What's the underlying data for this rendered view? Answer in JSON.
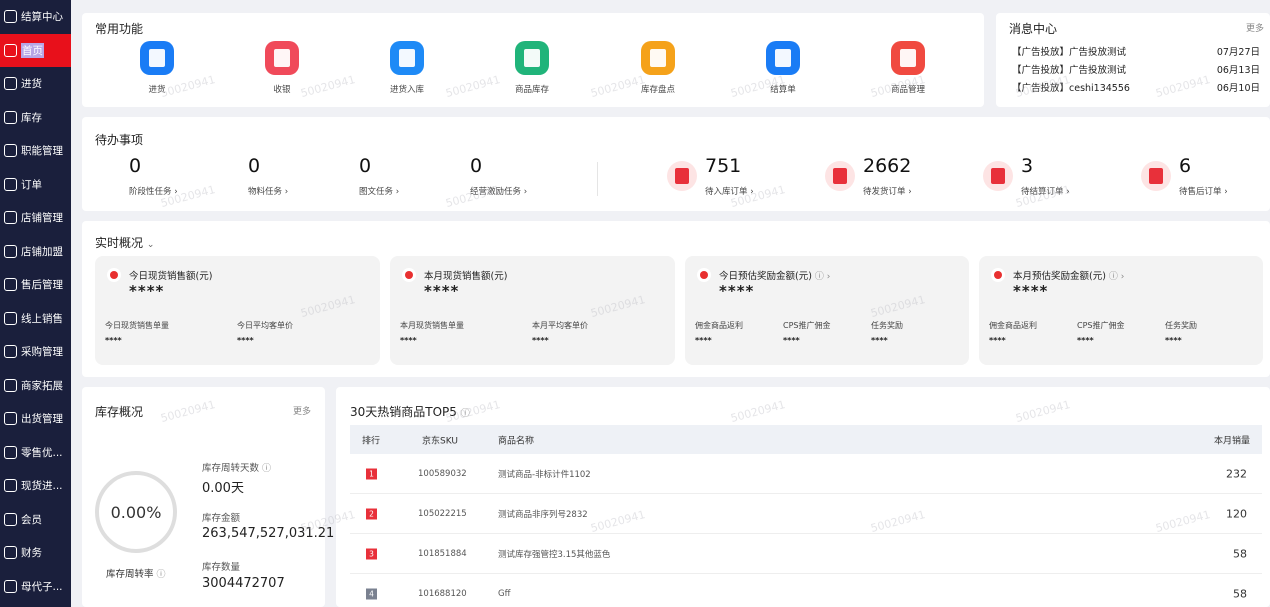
{
  "sidebar": {
    "items": [
      {
        "label": "结算中心"
      },
      {
        "label": "首页"
      },
      {
        "label": "进货"
      },
      {
        "label": "库存"
      },
      {
        "label": "职能管理"
      },
      {
        "label": "订单"
      },
      {
        "label": "店铺管理"
      },
      {
        "label": "店铺加盟"
      },
      {
        "label": "售后管理"
      },
      {
        "label": "线上销售"
      },
      {
        "label": "采购管理"
      },
      {
        "label": "商家拓展"
      },
      {
        "label": "出货管理"
      },
      {
        "label": "零售优..."
      },
      {
        "label": "现货进..."
      },
      {
        "label": "会员"
      },
      {
        "label": "财务"
      },
      {
        "label": "母代子..."
      }
    ]
  },
  "quick": {
    "title": "常用功能",
    "items": [
      {
        "label": "进货",
        "color": "#1a7cf5"
      },
      {
        "label": "收银",
        "color": "#f04a5a"
      },
      {
        "label": "进货入库",
        "color": "#1e8af6"
      },
      {
        "label": "商品库存",
        "color": "#20b47a"
      },
      {
        "label": "库存盘点",
        "color": "#f5a21a"
      },
      {
        "label": "结算单",
        "color": "#1a7cf5"
      },
      {
        "label": "商品管理",
        "color": "#f04a40"
      }
    ]
  },
  "messages": {
    "title": "消息中心",
    "more": "更多",
    "items": [
      {
        "text": "【广告投放】广告投放测试",
        "date": "07月27日"
      },
      {
        "text": "【广告投放】广告投放测试",
        "date": "06月13日"
      },
      {
        "text": "【广告投放】ceshi134556",
        "date": "06月10日"
      }
    ]
  },
  "todo": {
    "title": "待办事项",
    "items": [
      {
        "value": "0",
        "label": "阶段性任务 ›"
      },
      {
        "value": "0",
        "label": "物料任务 ›"
      },
      {
        "value": "0",
        "label": "图文任务 ›"
      },
      {
        "value": "0",
        "label": "经营激励任务 ›"
      },
      {
        "value": "751",
        "label": "待入库订单 ›"
      },
      {
        "value": "2662",
        "label": "待发货订单 ›"
      },
      {
        "value": "3",
        "label": "待结算订单 ›"
      },
      {
        "value": "6",
        "label": "待售后订单 ›"
      }
    ]
  },
  "realtime": {
    "title": "实时概况",
    "cards": [
      {
        "title": "今日现货销售额(元)",
        "value": "****",
        "subs": [
          {
            "label": "今日现货销售单量",
            "value": "****"
          },
          {
            "label": "今日平均客单价",
            "value": "****"
          }
        ]
      },
      {
        "title": "本月现货销售额(元)",
        "value": "****",
        "subs": [
          {
            "label": "本月现货销售单量",
            "value": "****"
          },
          {
            "label": "本月平均客单价",
            "value": "****"
          }
        ]
      },
      {
        "title": "今日预估奖励金额(元)",
        "value": "****",
        "subs": [
          {
            "label": "佣金商品返利",
            "value": "****"
          },
          {
            "label": "CPS推广佣金",
            "value": "****"
          },
          {
            "label": "任务奖励",
            "value": "****"
          }
        ]
      },
      {
        "title": "本月预估奖励金额(元)",
        "value": "****",
        "subs": [
          {
            "label": "佣金商品返利",
            "value": "****"
          },
          {
            "label": "CPS推广佣金",
            "value": "****"
          },
          {
            "label": "任务奖励",
            "value": "****"
          }
        ]
      }
    ]
  },
  "inventory": {
    "title": "库存概况",
    "more": "更多",
    "turnover_rate": "0.00%",
    "turnover_rate_label": "库存周转率",
    "turnover_days_label": "库存周转天数",
    "turnover_days": "0.00天",
    "amount_label": "库存金额",
    "amount": "263,547,527,031.21",
    "qty_label": "库存数量",
    "qty": "3004472707"
  },
  "top5": {
    "title": "30天热销商品TOP5",
    "headers": {
      "rank": "排行",
      "sku": "京东SKU",
      "name": "商品名称",
      "sales": "本月销量"
    },
    "rows": [
      {
        "rank": "1",
        "sku": "100589032",
        "name": "测试商品-非标计件1102",
        "sales": "232",
        "rank_color": "#e8303a"
      },
      {
        "rank": "2",
        "sku": "105022215",
        "name": "测试商品非序列号2832",
        "sales": "120",
        "rank_color": "#e8303a"
      },
      {
        "rank": "3",
        "sku": "101851884",
        "name": "测试库存强管控3.15其他蓝色",
        "sales": "58",
        "rank_color": "#e8303a"
      },
      {
        "rank": "4",
        "sku": "101688120",
        "name": "Gff",
        "sales": "58",
        "rank_color": "#7a8190"
      }
    ]
  },
  "watermark": "50020941"
}
